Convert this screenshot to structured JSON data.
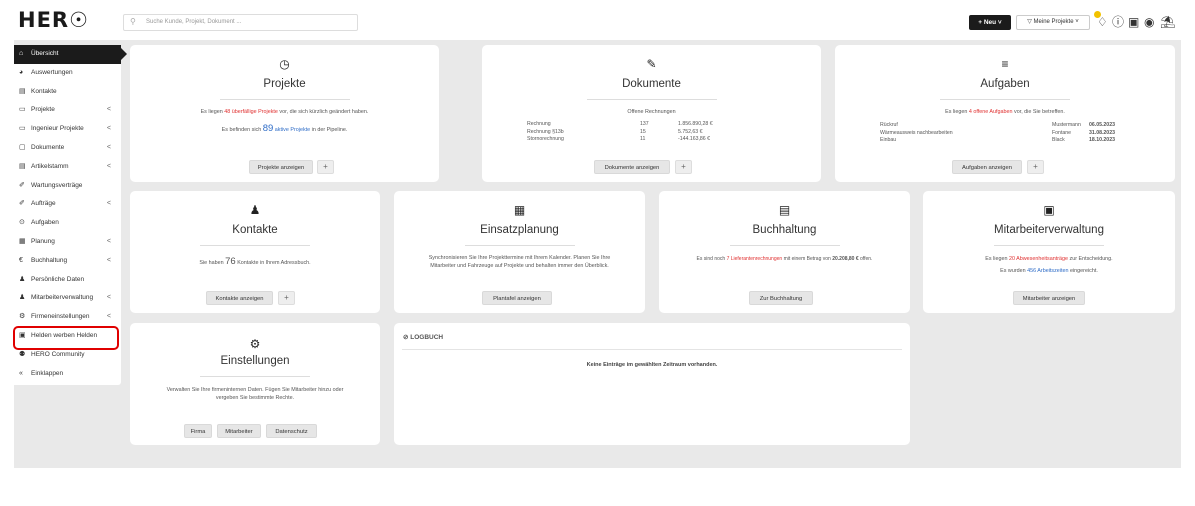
{
  "header": {
    "logo": "HER☉",
    "search_placeholder": "Suche Kunde, Projekt, Dokument ...",
    "new_button": "+ Neu ˅",
    "projects_filter": "▽ Meine Projekte ˅"
  },
  "sidebar": {
    "items": [
      {
        "label": "Übersicht",
        "icon": "⌂",
        "chevron": "",
        "active": true,
        "name": "uebersicht"
      },
      {
        "label": "Auswertungen",
        "icon": "◕",
        "chevron": "",
        "name": "auswertungen"
      },
      {
        "label": "Kontakte",
        "icon": "▤",
        "chevron": "",
        "name": "kontakte"
      },
      {
        "label": "Projekte",
        "icon": "▭",
        "chevron": "<",
        "name": "projekte"
      },
      {
        "label": "Ingenieur Projekte",
        "icon": "▭",
        "chevron": "<",
        "name": "ingenieur-projekte"
      },
      {
        "label": "Dokumente",
        "icon": "▢",
        "chevron": "<",
        "name": "dokumente"
      },
      {
        "label": "Artikelstamm",
        "icon": "▤",
        "chevron": "<",
        "name": "artikelstamm"
      },
      {
        "label": "Wartungsverträge",
        "icon": "✐",
        "chevron": "",
        "name": "wartungsvertraege"
      },
      {
        "label": "Aufträge",
        "icon": "✐",
        "chevron": "<",
        "name": "auftraege"
      },
      {
        "label": "Aufgaben",
        "icon": "⊙",
        "chevron": "",
        "name": "aufgaben"
      },
      {
        "label": "Planung",
        "icon": "▦",
        "chevron": "<",
        "name": "planung"
      },
      {
        "label": "Buchhaltung",
        "icon": "€",
        "chevron": "<",
        "name": "buchhaltung"
      },
      {
        "label": "Persönliche Daten",
        "icon": "♟",
        "chevron": "",
        "name": "persoenliche-daten"
      },
      {
        "label": "Mitarbeiterverwaltung",
        "icon": "♟",
        "chevron": "<",
        "name": "mitarbeiterverwaltung"
      },
      {
        "label": "Firmeneinstellungen",
        "icon": "⚙",
        "chevron": "<",
        "name": "firmeneinstellungen"
      },
      {
        "label": "Helden werben Helden",
        "icon": "▣",
        "chevron": "",
        "name": "helden-werben-helden"
      },
      {
        "label": "HERO Community",
        "icon": "⚉",
        "chevron": "",
        "name": "hero-community"
      },
      {
        "label": "Einklappen",
        "icon": "«",
        "chevron": "",
        "name": "einklappen"
      }
    ]
  },
  "projekte": {
    "title": "Projekte",
    "icon": "◷",
    "line1_pre": "Es liegen ",
    "line1_red": "48 überfällige Projekte",
    "line1_post": " vor, die sich kürzlich geändert haben.",
    "line2_pre": "Es befinden sich ",
    "line2_num": "89",
    "line2_blue": " aktive Projekte",
    "line2_post": " in der Pipeline.",
    "button": "Projekte anzeigen",
    "plus": "+"
  },
  "dokumente": {
    "title": "Dokumente",
    "icon": "✎",
    "subtitle": "Offene Rechnungen",
    "rows": [
      {
        "label": "Rechnung",
        "count": "137",
        "amount": "1.856.890,28 €"
      },
      {
        "label": "Rechnung §13b",
        "count": "15",
        "amount": "5.752,63 €"
      },
      {
        "label": "Stornorechnung",
        "count": "11",
        "amount": "-144.163,86 €"
      }
    ],
    "button": "Dokumente anzeigen",
    "plus": "+"
  },
  "aufgaben": {
    "title": "Aufgaben",
    "icon": "≡",
    "line_pre": "Es liegen ",
    "line_red": "4 offene Aufgaben",
    "line_post": " vor, die Sie betreffen.",
    "rows": [
      {
        "task": "Rückruf",
        "person": "Mustermann",
        "date": "06.05.2023"
      },
      {
        "task": "Wärmeausweis nachbearbeiten",
        "person": "Fontane",
        "date": "31.08.2023"
      },
      {
        "task": "Einbau",
        "person": "Black",
        "date": "18.10.2023"
      }
    ],
    "button": "Aufgaben anzeigen",
    "plus": "+"
  },
  "kontakte": {
    "title": "Kontakte",
    "icon": "♟",
    "line_pre": "Sie haben ",
    "line_num": "76",
    "line_post": " Kontakte in Ihrem Adressbuch.",
    "button": "Kontakte anzeigen",
    "plus": "+"
  },
  "einsatzplanung": {
    "title": "Einsatzplanung",
    "icon": "▦",
    "line1": "Synchronisieren Sie Ihre Projekttermine mit Ihrem Kalender. Planen Sie Ihre",
    "line2": "Mitarbeiter und Fahrzeuge auf Projekte und behalten immer den Überblick.",
    "button": "Plantafel anzeigen"
  },
  "buchhaltung": {
    "title": "Buchhaltung",
    "icon": "▤",
    "line_pre": "Es sind noch ",
    "line_red": "7 Lieferantenrechnungen",
    "line_mid": " mit einem Betrag von ",
    "line_amount": "20.208,80 €",
    "line_post": " offen.",
    "button": "Zur Buchhaltung"
  },
  "mitarbeiterverwaltung": {
    "title": "Mitarbeiterverwaltung",
    "icon": "▣",
    "line1_pre": "Es liegen ",
    "line1_red": "20 Abwesenheitsanträge",
    "line1_post": " zur Entscheidung.",
    "line2_pre": "Es wurden ",
    "line2_blue": "456 Arbeitszeiten",
    "line2_post": " eingereicht.",
    "button": "Mitarbeiter anzeigen"
  },
  "einstellungen": {
    "title": "Einstellungen",
    "icon": "⚙",
    "line1": "Verwalten Sie Ihre firmeninternen Daten. Fügen Sie Mitarbeiter hinzu oder",
    "line2": "vergeben Sie bestimmte Rechte.",
    "buttons": [
      "Firma",
      "Mitarbeiter",
      "Datenschutz"
    ]
  },
  "logbuch": {
    "title": "⊘ LOGBUCH",
    "empty": "Keine Einträge im gewählten Zeitraum vorhanden."
  }
}
